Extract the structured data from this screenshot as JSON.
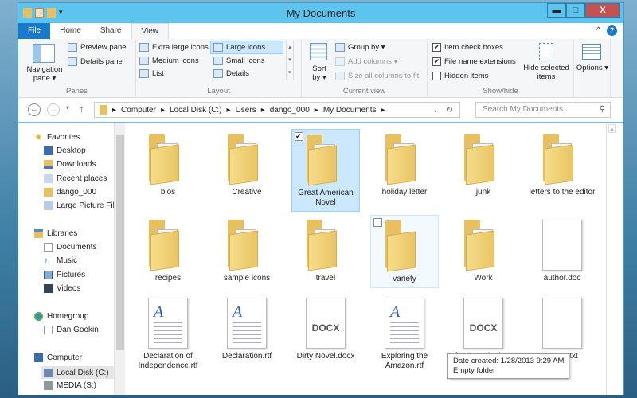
{
  "window": {
    "title": "My Documents",
    "minimize": "▬",
    "maximize": "□",
    "close": "X"
  },
  "tabs": {
    "file": "File",
    "home": "Home",
    "share": "Share",
    "view": "View"
  },
  "ribbon": {
    "panes": {
      "navigation_pane": "Navigation pane ▾",
      "preview_pane": "Preview pane",
      "details_pane": "Details pane",
      "label": "Panes"
    },
    "layout": {
      "items": [
        "Extra large icons",
        "Large icons",
        "Medium icons",
        "Small icons",
        "List",
        "Details"
      ],
      "selected": "Large icons",
      "label": "Layout"
    },
    "current_view": {
      "sort_by": "Sort by ▾",
      "group_by": "Group by ▾",
      "add_columns": "Add columns ▾",
      "size_columns": "Size all columns to fit",
      "label": "Current view"
    },
    "show_hide": {
      "item_check_boxes": {
        "label": "Item check boxes",
        "checked": true
      },
      "file_name_extensions": {
        "label": "File name extensions",
        "checked": true
      },
      "hidden_items": {
        "label": "Hidden items",
        "checked": false
      },
      "hide_selected": "Hide selected items",
      "label": "Show/hide"
    },
    "options": "Options ▾"
  },
  "address": {
    "path": [
      "Computer",
      "Local Disk (C:)",
      "Users",
      "dango_000",
      "My Documents"
    ],
    "search_placeholder": "Search My Documents"
  },
  "nav": {
    "favorites": {
      "label": "Favorites",
      "items": [
        "Desktop",
        "Downloads",
        "Recent places",
        "dango_000",
        "Large Picture Files"
      ]
    },
    "libraries": {
      "label": "Libraries",
      "items": [
        "Documents",
        "Music",
        "Pictures",
        "Videos"
      ]
    },
    "homegroup": {
      "label": "Homegroup",
      "items": [
        "Dan Gookin"
      ]
    },
    "computer": {
      "label": "Computer",
      "items": [
        "Local Disk (C:)",
        "MEDIA (S:)"
      ]
    }
  },
  "files": [
    {
      "name": "bios",
      "type": "folder"
    },
    {
      "name": "Creative",
      "type": "folder"
    },
    {
      "name": "Great American Novel",
      "type": "folder",
      "selected": true
    },
    {
      "name": "holiday letter",
      "type": "folder"
    },
    {
      "name": "junk",
      "type": "folder"
    },
    {
      "name": "letters to the editor",
      "type": "folder"
    },
    {
      "name": "recipes",
      "type": "folder"
    },
    {
      "name": "sample icons",
      "type": "folder"
    },
    {
      "name": "travel",
      "type": "folder"
    },
    {
      "name": "variety",
      "type": "folder",
      "hovered": true
    },
    {
      "name": "Work",
      "type": "folder"
    },
    {
      "name": "author.doc",
      "type": "doc"
    },
    {
      "name": "Declaration of Independence.rtf",
      "type": "rtf"
    },
    {
      "name": "Declaration.rtf",
      "type": "rtf"
    },
    {
      "name": "Dirty Novel.docx",
      "type": "docx"
    },
    {
      "name": "Exploring the Amazon.rtf",
      "type": "rtf"
    },
    {
      "name": "first sample.docx",
      "type": "docx"
    },
    {
      "name": "Poem.txt",
      "type": "txt"
    }
  ],
  "docx_badge": "DOCX",
  "tooltip": {
    "line1": "Date created: 1/28/2013 9:29 AM",
    "line2": "Empty folder"
  }
}
